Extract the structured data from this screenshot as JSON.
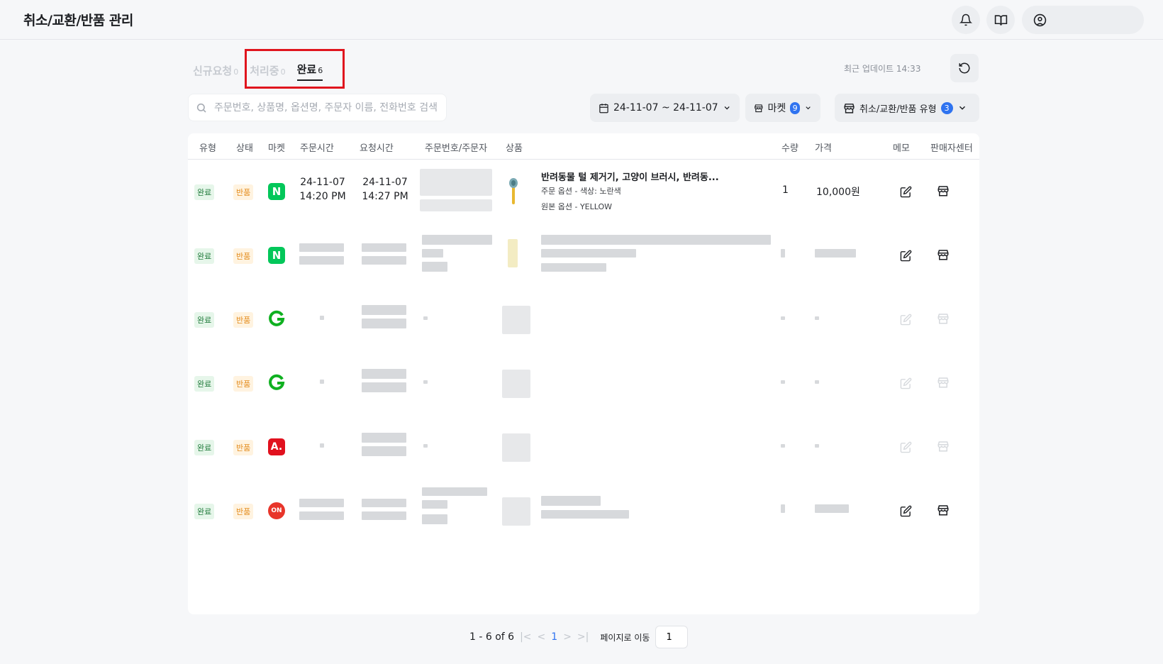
{
  "header": {
    "title": "취소/교환/반품 관리"
  },
  "tabs": [
    {
      "label": "신규요청",
      "count": "0"
    },
    {
      "label": "처리중",
      "count": "0"
    },
    {
      "label": "완료",
      "count": "6"
    }
  ],
  "last_update": "최근 업데이트 14:33",
  "search": {
    "placeholder": "주문번호, 상품명, 옵션명, 주문자 이름, 전화번호 검색"
  },
  "filters": {
    "date_range": "24-11-07 ~ 24-11-07",
    "market_label": "마켓",
    "market_count": "9",
    "type_label": "취소/교환/반품 유형",
    "type_count": "3"
  },
  "table": {
    "columns": [
      "유형",
      "상태",
      "마켓",
      "주문시간",
      "요청시간",
      "주문번호/주문자",
      "상품",
      "수량",
      "가격",
      "메모",
      "판매자센터"
    ],
    "rows": [
      {
        "type": "완료",
        "status": "반품",
        "market": "N",
        "order_date": "24-11-07",
        "order_time": "14:20 PM",
        "req_date": "24-11-07",
        "req_time": "14:27 PM",
        "product_name": "반려동물 털 제거기, 고양이 브러시, 반려동...",
        "option": "주문 옵션 - 색상: 노란색",
        "orig_option": "원본 옵션 - YELLOW",
        "qty": "1",
        "price": "10,000원"
      },
      {
        "type": "완료",
        "status": "반품",
        "market": "N"
      },
      {
        "type": "완료",
        "status": "반품",
        "market": "G"
      },
      {
        "type": "완료",
        "status": "반품",
        "market": "G"
      },
      {
        "type": "완료",
        "status": "반품",
        "market": "A."
      },
      {
        "type": "완료",
        "status": "반품",
        "market": "ON"
      }
    ]
  },
  "pagination": {
    "summary": "1 - 6 of 6",
    "current": "1",
    "goto_label": "페이지로 이동",
    "goto_value": "1"
  },
  "colors": {
    "accent": "#2f73f0",
    "highlight": "#e0151e",
    "naver": "#03c75a",
    "gmarket": "#0fb020",
    "auction": "#e1111e",
    "lotteon": "#e8352a"
  }
}
